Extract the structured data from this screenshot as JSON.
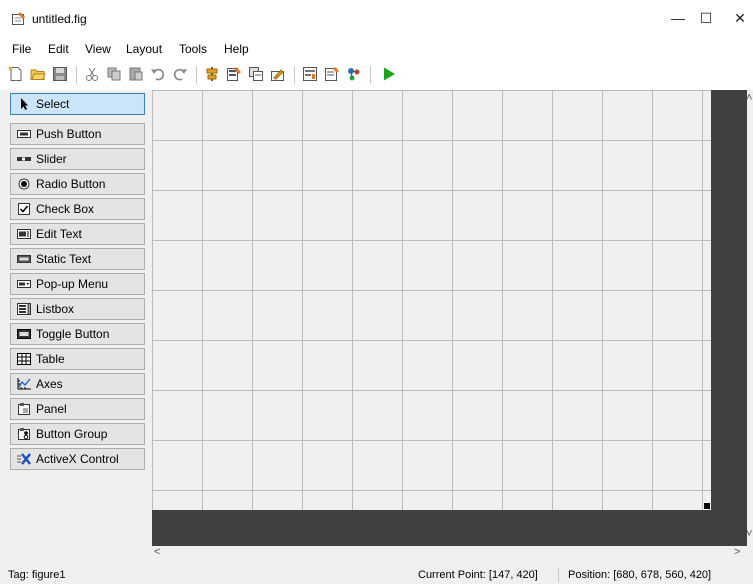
{
  "window": {
    "title": "untitled.fig",
    "minimize": "—",
    "maximize": "☐",
    "close": "✕"
  },
  "menu": [
    "File",
    "Edit",
    "View",
    "Layout",
    "Tools",
    "Help"
  ],
  "toolbar": {
    "icons": [
      "new-file-icon",
      "open-folder-icon",
      "save-icon",
      "cut-icon",
      "copy-icon",
      "paste-icon",
      "undo-icon",
      "redo-icon",
      "align-objects-icon",
      "menu-editor-icon",
      "tab-order-editor-icon",
      "toolbar-editor-icon",
      "editor-icon",
      "property-inspector-icon",
      "object-browser-icon",
      "run-figure-icon"
    ]
  },
  "palette": {
    "items": [
      {
        "label": "Select",
        "icon": "arrow-cursor-icon",
        "selected": true
      },
      {
        "label": "Push Button",
        "icon": "push-button-icon",
        "selected": false
      },
      {
        "label": "Slider",
        "icon": "slider-icon",
        "selected": false
      },
      {
        "label": "Radio Button",
        "icon": "radio-button-icon",
        "selected": false
      },
      {
        "label": "Check Box",
        "icon": "check-box-icon",
        "selected": false
      },
      {
        "label": "Edit Text",
        "icon": "edit-text-icon",
        "selected": false
      },
      {
        "label": "Static Text",
        "icon": "static-text-icon",
        "selected": false
      },
      {
        "label": "Pop-up Menu",
        "icon": "popup-menu-icon",
        "selected": false
      },
      {
        "label": "Listbox",
        "icon": "listbox-icon",
        "selected": false
      },
      {
        "label": "Toggle Button",
        "icon": "toggle-button-icon",
        "selected": false
      },
      {
        "label": "Table",
        "icon": "table-icon",
        "selected": false
      },
      {
        "label": "Axes",
        "icon": "axes-icon",
        "selected": false
      },
      {
        "label": "Panel",
        "icon": "panel-icon",
        "selected": false
      },
      {
        "label": "Button Group",
        "icon": "button-group-icon",
        "selected": false
      },
      {
        "label": "ActiveX Control",
        "icon": "activex-icon",
        "selected": false
      }
    ]
  },
  "scroll": {
    "up": "˄",
    "down": "˅",
    "left": "<",
    "right": ">"
  },
  "status": {
    "tag": "Tag: figure1",
    "current_point": "Current Point:  [147, 420]",
    "position": "Position: [680, 678, 560, 420]"
  },
  "colors": {
    "canvas": "#f0f0f0",
    "grid": "#bcbcbc",
    "dark_border": "#404040",
    "selected_item": "#cce4f7",
    "run_green": "#1fa31f"
  }
}
